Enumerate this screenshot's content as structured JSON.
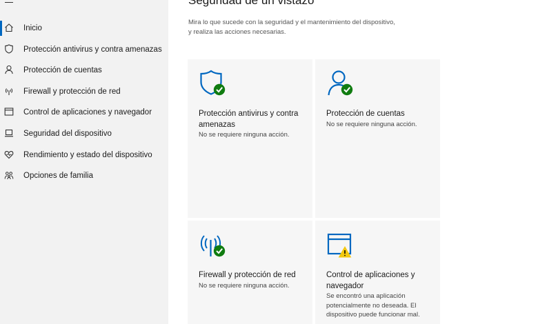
{
  "window": {
    "background": "#ffffff",
    "sidebar_background": "#f2f2f2",
    "accent": "#0067c0"
  },
  "sidebar": {
    "menu_icon": "hamburger-menu-icon",
    "items": [
      {
        "icon": "home-icon",
        "label": "Inicio",
        "selected": true
      },
      {
        "icon": "shield-icon",
        "label": "Protección antivirus y contra amenazas"
      },
      {
        "icon": "person-icon",
        "label": "Protección de cuentas"
      },
      {
        "icon": "wifi-signal-icon",
        "label": "Firewall y protección de red"
      },
      {
        "icon": "app-browser-icon",
        "label": "Control de aplicaciones y navegador"
      },
      {
        "icon": "laptop-icon",
        "label": "Seguridad del dispositivo"
      },
      {
        "icon": "heart-pulse-icon",
        "label": "Rendimiento y estado del dispositivo"
      },
      {
        "icon": "family-icon",
        "label": "Opciones de familia"
      }
    ]
  },
  "main": {
    "title": "Seguridad de un vistazo",
    "subtitle": "Mira lo que sucede con la seguridad y el mantenimiento del dispositivo, y realiza las acciones necesarias."
  },
  "cards": [
    {
      "icon": "shield-check-icon",
      "title": "Protección antivirus y contra amenazas",
      "status": "No se requiere ninguna acción.",
      "status_color": "#107c10"
    },
    {
      "icon": "account-check-icon",
      "title": "Protección de cuentas",
      "status": "No se requiere ninguna acción.",
      "status_color": "#107c10"
    },
    {
      "icon": "firewall-check-icon",
      "title": "Firewall y protección de red",
      "status": "No se requiere ninguna acción.",
      "status_color": "#107c10"
    },
    {
      "icon": "app-browser-warning-icon",
      "title": "Control de aplicaciones y navegador",
      "status": "Se encontró una aplicación potencialmente no deseada. El dispositivo puede funcionar mal.",
      "status_color": "#f2c811"
    }
  ]
}
